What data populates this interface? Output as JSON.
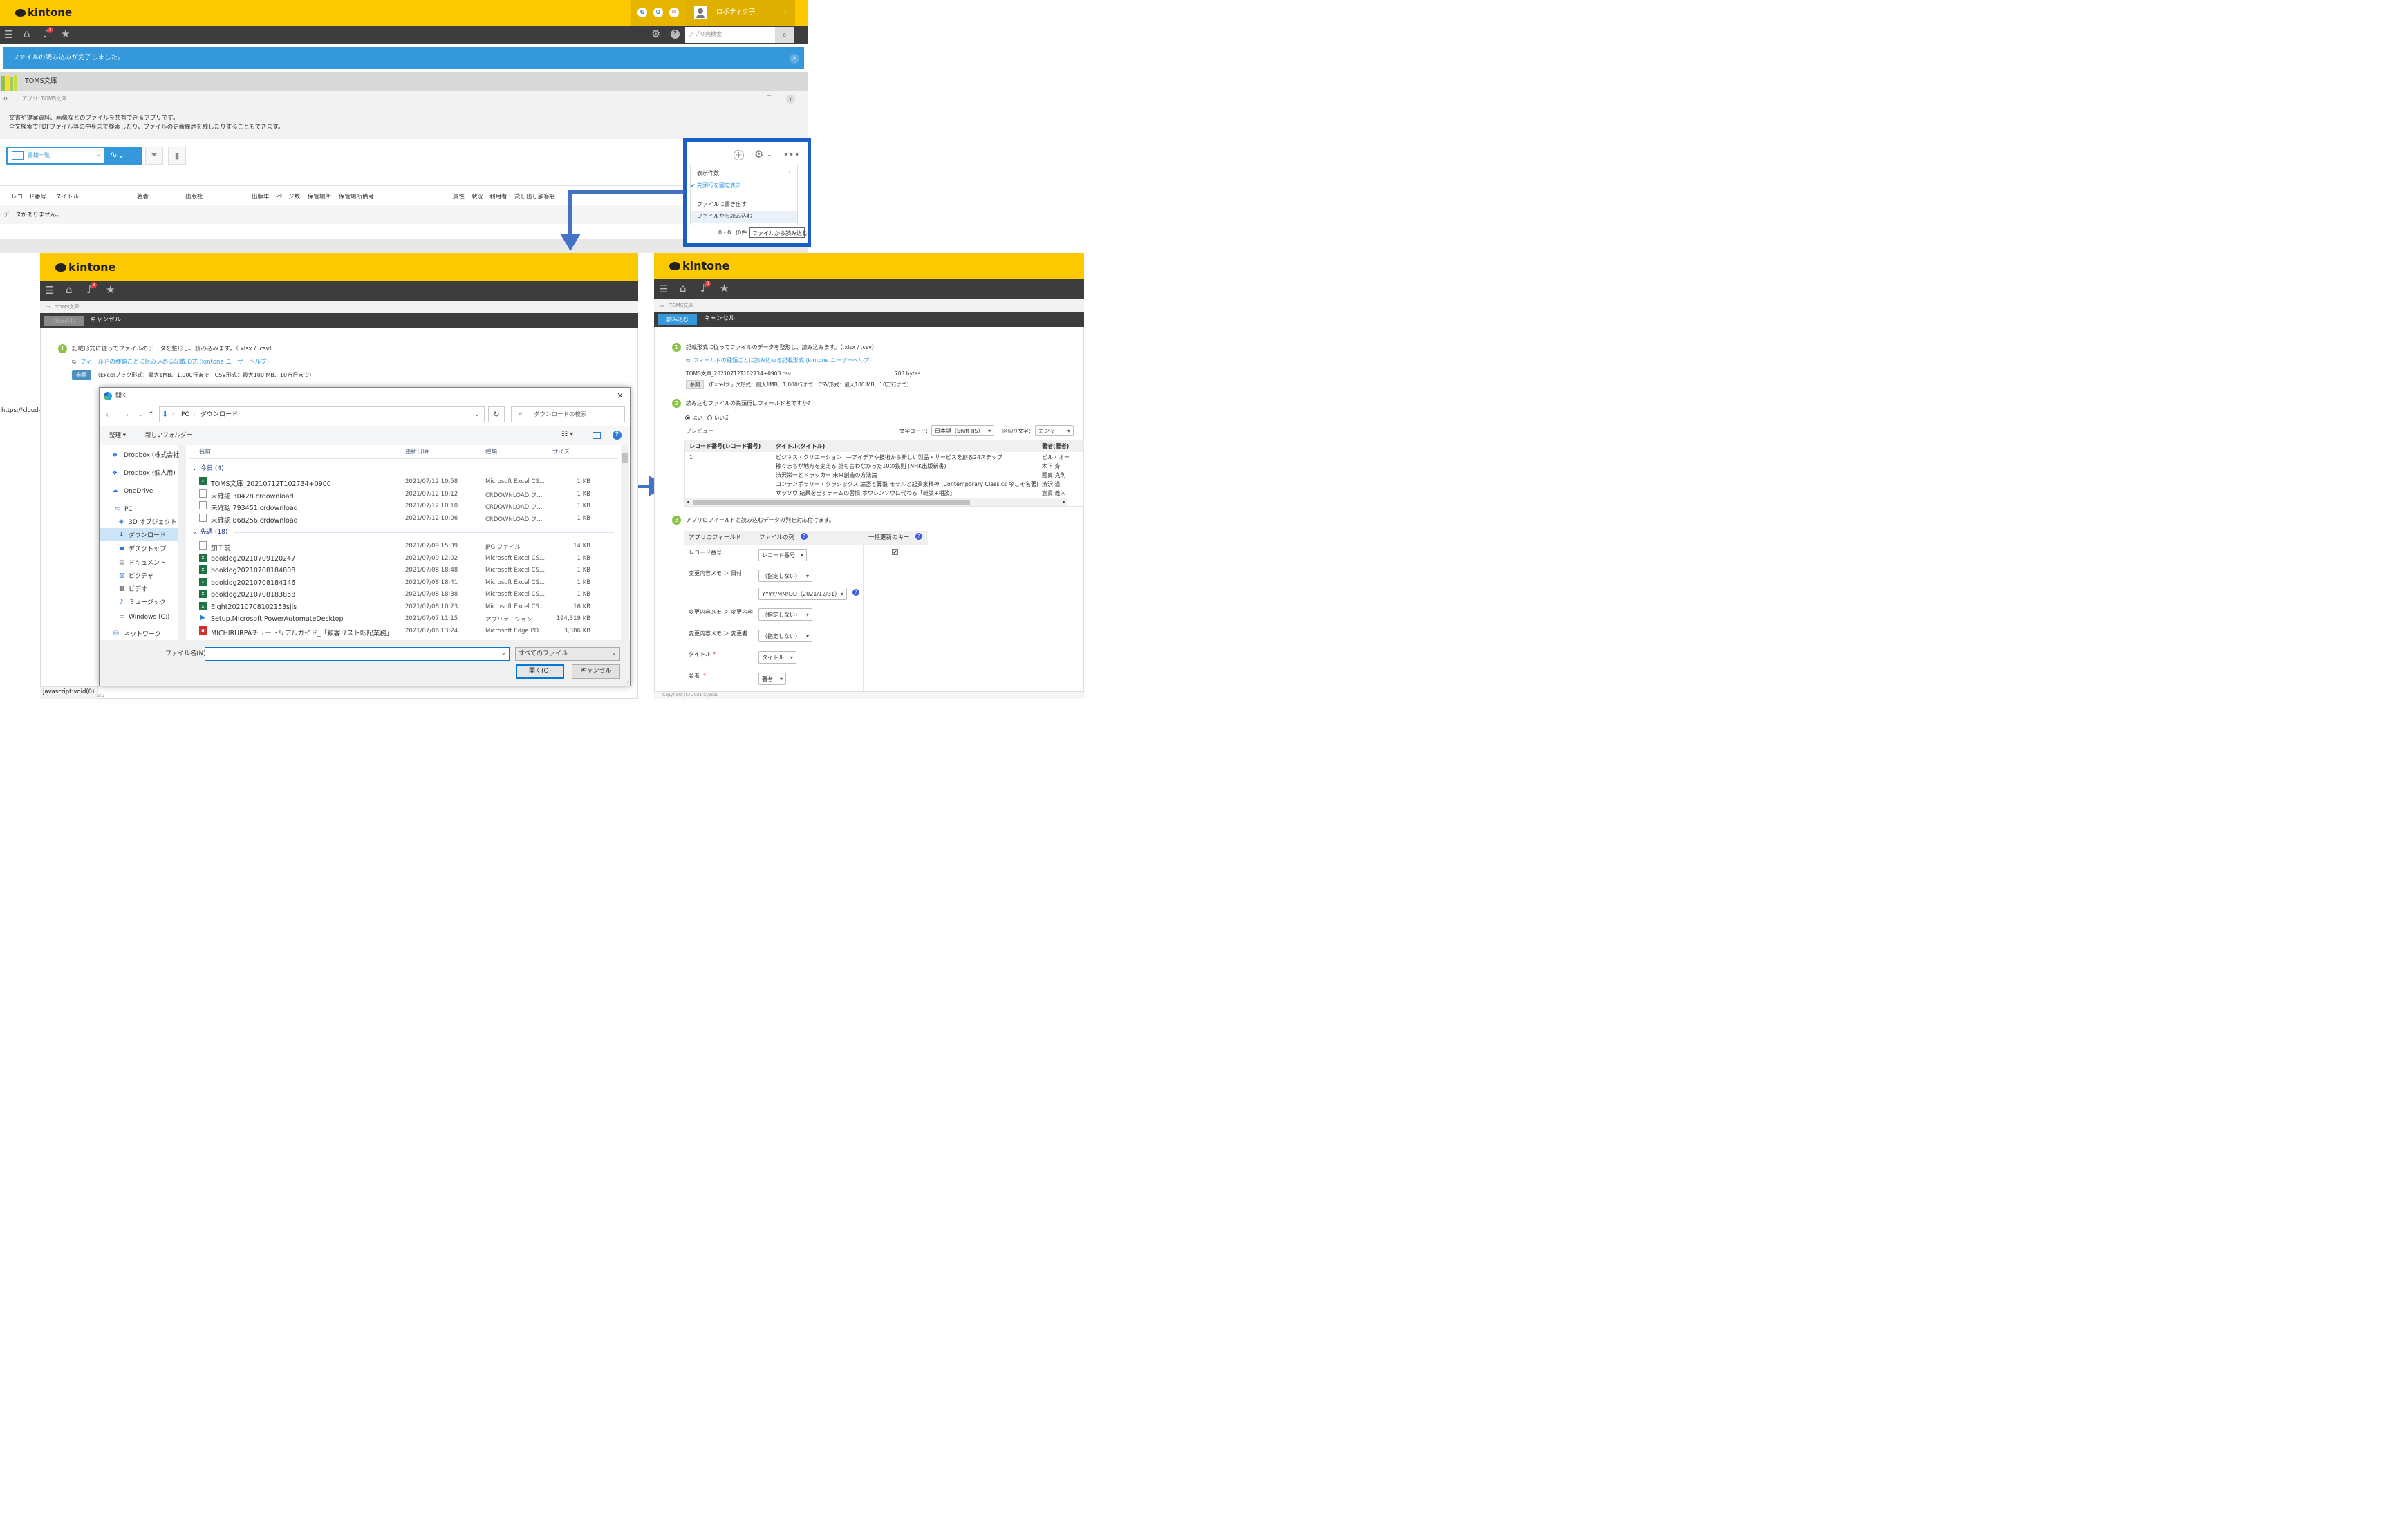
{
  "brand": {
    "logo": "kintone",
    "yellow": "#fcc800",
    "dark": "#3d3d3d",
    "accent_blue": "#3498db",
    "frame_blue": "#1a5fc8"
  },
  "top": {
    "user_name": "ロボティク子",
    "notif_count": "3",
    "search_placeholder": "アプリ内検索",
    "banner": "ファイルの読み込みが完了しました。",
    "banner_close": "×",
    "app_name": "TOMS文庫",
    "breadcrumb": "アプリ: TOMS文庫",
    "desc1": "文書や提案資料、画像などのファイルを共有できるアプリです。",
    "desc2": "全文検索でPDFファイル等の中身まで検索したり、ファイルの更新履歴を残したりすることもできます。",
    "view_name": "書籍一覧",
    "columns": [
      "レコード番号",
      "タイトル",
      "著者",
      "出版社",
      "出版年",
      "ページ数",
      "保管場所",
      "保管場所備考",
      "属性",
      "状況",
      "利用者",
      "貸し出し顧客名"
    ],
    "no_data": "データがありません。",
    "url_hint": "https://cloud-"
  },
  "menu": {
    "items": [
      "表示件数",
      "先頭行を固定表示",
      "ファイルに書き出す",
      "ファイルから読み込む"
    ],
    "paging": "0 - 0",
    "paging_suffix": "(0件",
    "tooltip": "ファイルから読み込む"
  },
  "left": {
    "app_path": "TOMS文庫",
    "import_btn": "読み込む",
    "cancel_btn": "キャンセル",
    "step1": "記載形式に従ってファイルのデータを整形し、読み込みます。（.xlsx / .csv）",
    "help_link": "フィールドの種類ごとに読み込める記載形式 (kintone ユーザーヘルプ)",
    "browse": "参照",
    "limits": "（Excelブック形式：最大1MB、1,000行まで　CSV形式：最大100 MB、10万行まで）",
    "status_hint": "javascript:void(0)",
    "status_suffix": "ozu"
  },
  "dialog": {
    "title": "開く",
    "close": "×",
    "path": [
      "PC",
      "ダウンロード"
    ],
    "search_placeholder": "ダウンロードの検索",
    "organize": "整理 ▾",
    "new_folder": "新しいフォルダー",
    "nav": [
      "Dropbox (株式会社",
      "Dropbox (個人用)",
      "OneDrive",
      "PC",
      "3D オブジェクト",
      "ダウンロード",
      "デスクトップ",
      "ドキュメント",
      "ピクチャ",
      "ビデオ",
      "ミュージック",
      "Windows (C:)",
      "ネットワーク"
    ],
    "headers": [
      "名前",
      "更新日時",
      "種類",
      "サイズ"
    ],
    "group_today": "今日 (4)",
    "group_last_week": "先週 (18)",
    "files_today": [
      {
        "name": "TOMS文庫_20210712T102734+0900",
        "date": "2021/07/12 10:58",
        "type": "Microsoft Excel CS...",
        "size": "1 KB",
        "icon": "excel"
      },
      {
        "name": "未確認 30428.crdownload",
        "date": "2021/07/12 10:12",
        "type": "CRDOWNLOAD フ...",
        "size": "1 KB",
        "icon": "doc"
      },
      {
        "name": "未確認 793451.crdownload",
        "date": "2021/07/12 10:10",
        "type": "CRDOWNLOAD フ...",
        "size": "1 KB",
        "icon": "doc"
      },
      {
        "name": "未確認 868256.crdownload",
        "date": "2021/07/12 10:06",
        "type": "CRDOWNLOAD フ...",
        "size": "1 KB",
        "icon": "doc"
      }
    ],
    "files_week": [
      {
        "name": "加工前",
        "date": "2021/07/09 15:39",
        "type": "JPG ファイル",
        "size": "14 KB",
        "icon": "doc"
      },
      {
        "name": "booklog20210709120247",
        "date": "2021/07/09 12:02",
        "type": "Microsoft Excel CS...",
        "size": "1 KB",
        "icon": "excel"
      },
      {
        "name": "booklog20210708184808",
        "date": "2021/07/08 18:48",
        "type": "Microsoft Excel CS...",
        "size": "1 KB",
        "icon": "excel"
      },
      {
        "name": "booklog20210708184146",
        "date": "2021/07/08 18:41",
        "type": "Microsoft Excel CS...",
        "size": "1 KB",
        "icon": "excel"
      },
      {
        "name": "booklog20210708183858",
        "date": "2021/07/08 18:38",
        "type": "Microsoft Excel CS...",
        "size": "1 KB",
        "icon": "excel"
      },
      {
        "name": "Eight20210708102153sjis",
        "date": "2021/07/08 10:23",
        "type": "Microsoft Excel CS...",
        "size": "16 KB",
        "icon": "excel"
      },
      {
        "name": "Setup.Microsoft.PowerAutomateDesktop",
        "date": "2021/07/07 11:15",
        "type": "アプリケーション",
        "size": "194,319 KB",
        "icon": "app"
      },
      {
        "name": "MICHIRURPAチュートリアルガイド_「顧客リスト転記業務」",
        "date": "2021/07/06 13:24",
        "type": "Microsoft Edge PD...",
        "size": "3,386 KB",
        "icon": "pdf"
      }
    ],
    "filename_label": "ファイル名(N):",
    "filename_value": "",
    "filetype": "すべてのファイル",
    "open_btn": "開く(O)",
    "cancel_btn": "キャンセル"
  },
  "right": {
    "app_path": "TOMS文庫",
    "import_btn": "読み込む",
    "cancel_btn": "キャンセル",
    "step1": "記載形式に従ってファイルのデータを整形し、読み込みます。（.xlsx / .csv）",
    "help_link": "フィールドの種類ごとに読み込める記載形式 (kintone ユーザーヘルプ)",
    "file_name": "TOMS文庫_20210712T102734+0900.csv",
    "file_size": "783 bytes",
    "browse": "参照",
    "limits": "（Excelブック形式：最大1MB、1,000行まで　CSV形式：最大100 MB、10万行まで）",
    "step2": "読み込むファイルの先頭行はフィールド名ですか？",
    "yes": "はい",
    "no": "いいえ",
    "preview": "プレビュー",
    "charcode_label": "文字コード：",
    "charcode": "日本語（Shift JIS）",
    "delimiter_label": "区切り文字：",
    "delimiter": "カンマ",
    "preview_headers": [
      "レコード番号(レコード番号)",
      "タイトル(タイトル)",
      "著者(著者)"
    ],
    "preview_rows": [
      [
        "1",
        "ビジネス・クリエーション! ---アイデアや技術から新しい製品・サービスを創る24ステップ",
        "ビル・オー"
      ],
      [
        "",
        "稼ぐまちが地方を変える 誰も言わなかった10の鉄則 (NHK出版新書)",
        "木下 斉"
      ],
      [
        "",
        "渋沢栄一とドラッカー 未来創造の方法論",
        "國貞 克則"
      ],
      [
        "",
        "コンテンポラリー・クラシックス 論語と算盤 モラルと起業家精神 (Contemporary Classics 今こそ名著)",
        "渋沢 道"
      ],
      [
        "",
        "ザッソウ 結果を出すチームの習慣 ホウレンソウに代わる「雑談+相談」",
        "倉貫 義人"
      ]
    ],
    "step3": "アプリのフィールドと読み込むデータの列を対応付けます。",
    "map_headers": [
      "アプリのフィールド",
      "ファイルの列",
      "一括更新のキー"
    ],
    "map_rows": [
      {
        "field": "レコード番号",
        "col": "レコード番号"
      },
      {
        "field": "変更内容メモ ＞ 日付",
        "col": "（指定しない）"
      },
      {
        "field": "",
        "col": "YYYY/MM/DD（2021/12/31）"
      },
      {
        "field": "変更内容メモ ＞ 変更内容",
        "col": "（指定しない）"
      },
      {
        "field": "変更内容メモ ＞ 変更者",
        "col": "（指定しない）"
      },
      {
        "field": "タイトル",
        "col": "タイトル"
      },
      {
        "field": "著者",
        "col": "著者"
      }
    ],
    "footer": "Copyright (C) 2021 Cybozu"
  }
}
